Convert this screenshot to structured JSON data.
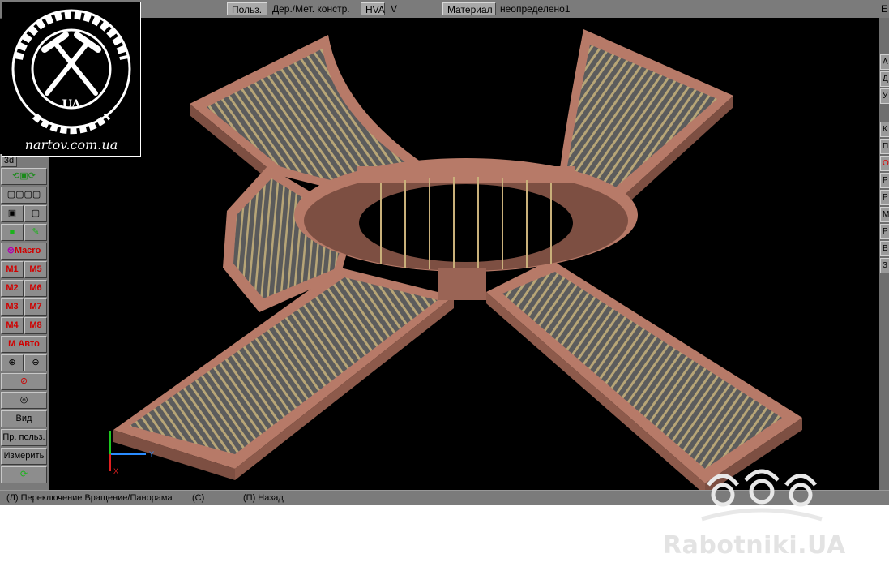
{
  "topbar": {
    "user_btn": "Польз.",
    "wood_metal": "Дер./Мет. констр.",
    "hva_btn": "HVA",
    "v_label": "V",
    "material_btn": "Материал",
    "material_value": "неопределено1",
    "right_cut": "Е"
  },
  "left_toolbar": {
    "mode_3d": "3d",
    "macro": "Macro",
    "m1": "M1",
    "m5": "M5",
    "m2": "M2",
    "m6": "M6",
    "m3": "M3",
    "m7": "M7",
    "m4": "M4",
    "m8": "M8",
    "m_auto": "M Авто",
    "view": "Вид",
    "user_pr": "Пр. польз.",
    "measure": "Измерить"
  },
  "right_toolbar": {
    "items": [
      "A",
      "Д",
      "У",
      "К",
      "П",
      "О",
      "Р",
      "Р",
      "М",
      "Р",
      "В",
      "З"
    ]
  },
  "status": {
    "left": "(Л) Переключение Вращение/Панорама",
    "center": "(С)",
    "right": "(П) Назад"
  },
  "logo": {
    "url": "nartov.com.ua",
    "badge": "UA"
  },
  "watermark": "Rabotniki.UA",
  "axes": {
    "x": "X",
    "y": "Y"
  },
  "colors": {
    "background": "#000000",
    "wall": "#b77a68",
    "roof": "#6a6a6a",
    "timber": "#c9b07a",
    "macro_red": "#d00000"
  }
}
